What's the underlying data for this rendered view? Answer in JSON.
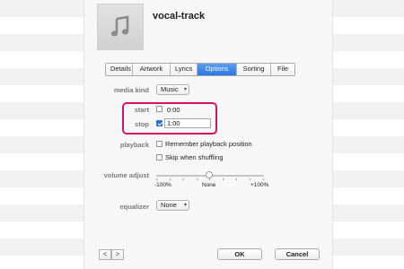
{
  "track": {
    "title": "vocal-track",
    "artwork_icon": "music-note-icon"
  },
  "tabs": [
    {
      "label": "Details",
      "active": false
    },
    {
      "label": "Artwork",
      "active": false
    },
    {
      "label": "Lyrics",
      "active": false
    },
    {
      "label": "Options",
      "active": true
    },
    {
      "label": "Sorting",
      "active": false
    },
    {
      "label": "File",
      "active": false
    }
  ],
  "options": {
    "media_kind_label": "media kind",
    "media_kind_value": "Music",
    "start_label": "start",
    "start_checked": false,
    "start_value": "0:00",
    "stop_label": "stop",
    "stop_checked": true,
    "stop_value": "1:00",
    "playback_label": "playback",
    "remember_position": "Remember playback position",
    "skip_shuffling": "Skip when shuffling",
    "volume_label": "volume adjust",
    "volume_min": "-100%",
    "volume_mid": "None",
    "volume_max": "+100%",
    "equalizer_label": "equalizer",
    "equalizer_value": "None"
  },
  "footer": {
    "prev_icon": "chevron-left-icon",
    "next_icon": "chevron-right-icon",
    "prev_glyph": "<",
    "next_glyph": ">",
    "ok_label": "OK",
    "cancel_label": "Cancel"
  },
  "colors": {
    "highlight": "#d6115f",
    "active_tab": "#2a75e3"
  }
}
